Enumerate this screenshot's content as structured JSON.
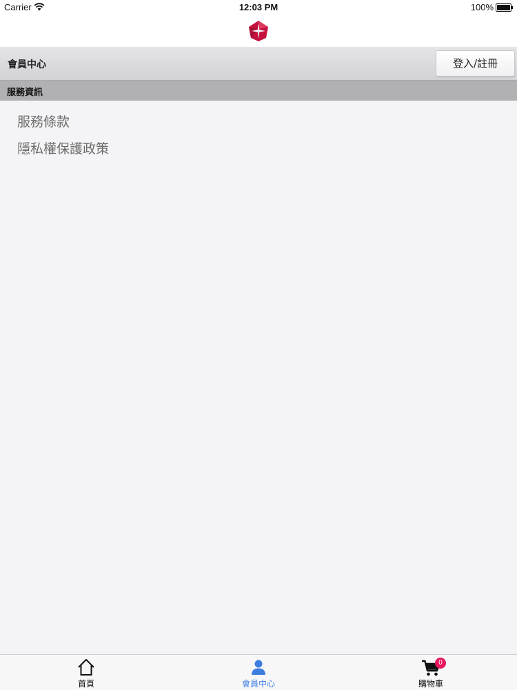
{
  "status_bar": {
    "carrier": "Carrier",
    "time": "12:03 PM",
    "battery": "100%"
  },
  "header": {
    "logo_icon": "ruby-star-logo",
    "brand_color": "#c4123f"
  },
  "member_bar": {
    "title": "會員中心",
    "login_label": "登入/註冊"
  },
  "section": {
    "title": "服務資訊",
    "items": [
      {
        "label": "服務條款"
      },
      {
        "label": "隱私權保護政策"
      }
    ]
  },
  "tab_bar": {
    "active_color": "#3e7de0",
    "tabs": [
      {
        "label": "首頁",
        "icon": "home-icon"
      },
      {
        "label": "會員中心",
        "icon": "person-icon"
      },
      {
        "label": "購物車",
        "icon": "cart-icon",
        "badge": "0"
      }
    ]
  }
}
